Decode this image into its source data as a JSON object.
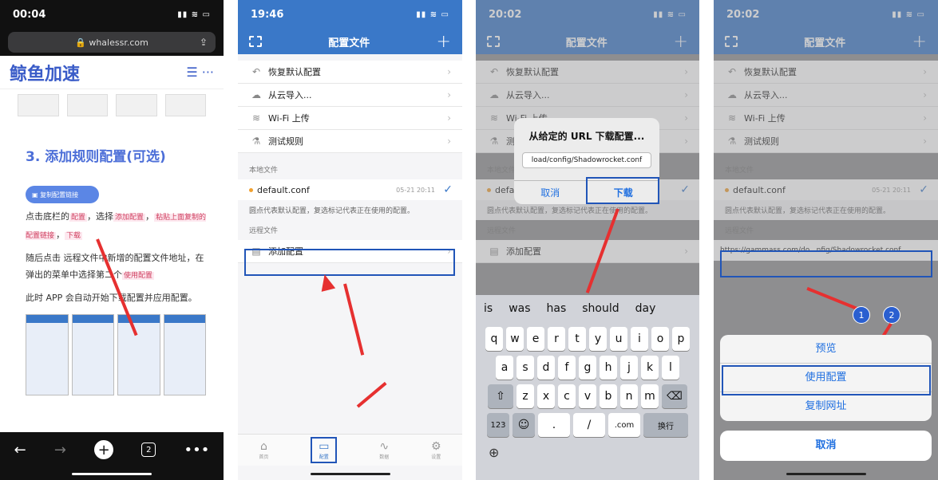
{
  "p1": {
    "time": "00:04",
    "url": "whalessr.com",
    "site_name": "鲸鱼加速",
    "heading": "3. 添加规则配置(可选)",
    "copy_btn": "复制配置链接",
    "line1a": "点击底栏的",
    "line1_hl1": "配置",
    "line1b": "，选择",
    "line1_hl2": "添加配置",
    "line1c": "，",
    "line1_hl3": "粘贴上面复制的配置链接",
    "line1d": "，",
    "line1_hl4": "下载",
    "line2": "随后点击 远程文件中新增的配置文件地址，在弹出的菜单中选择第二个",
    "line2_hl": "使用配置",
    "line3": "此时 APP 会自动开始下载配置并应用配置。",
    "tabs_count": "2"
  },
  "p2": {
    "time": "19:46",
    "title": "配置文件",
    "items": [
      {
        "icon": "restore-icon",
        "label": "恢复默认配置"
      },
      {
        "icon": "cloud-icon",
        "label": "从云导入..."
      },
      {
        "icon": "wifi-icon",
        "label": "Wi-Fi 上传"
      },
      {
        "icon": "test-icon",
        "label": "测试规则"
      }
    ],
    "local_section": "本地文件",
    "file": "default.conf",
    "file_time": "05-21 20:11",
    "note": "圆点代表默认配置，复选标记代表正在使用的配置。",
    "remote_section": "远程文件",
    "add_config": "添加配置",
    "tabs": [
      "首页",
      "配置",
      "数据",
      "设置"
    ]
  },
  "p3": {
    "time": "20:02",
    "title": "配置文件",
    "dialog_title": "从给定的 URL 下载配置...",
    "dialog_input": "load/config/Shadowrocket.conf",
    "cancel": "取消",
    "download": "下载",
    "suggestions": [
      "is",
      "was",
      "has",
      "should",
      "day"
    ],
    "row1": [
      "q",
      "w",
      "e",
      "r",
      "t",
      "y",
      "u",
      "i",
      "o",
      "p"
    ],
    "row2": [
      "a",
      "s",
      "d",
      "f",
      "g",
      "h",
      "j",
      "k",
      "l"
    ],
    "row3": [
      "z",
      "x",
      "c",
      "v",
      "b",
      "n",
      "m"
    ],
    "num_key": "123",
    "dot_key": ".",
    "slash_key": "/",
    "com_key": ".com",
    "return_key": "换行"
  },
  "p4": {
    "time": "20:02",
    "title": "配置文件",
    "remote_url": "https://gammass.com/do...nfig/Shadowrocket.conf",
    "menu": [
      "预览",
      "使用配置",
      "复制网址"
    ],
    "cancel": "取消",
    "badge1": "1",
    "badge2": "2"
  }
}
